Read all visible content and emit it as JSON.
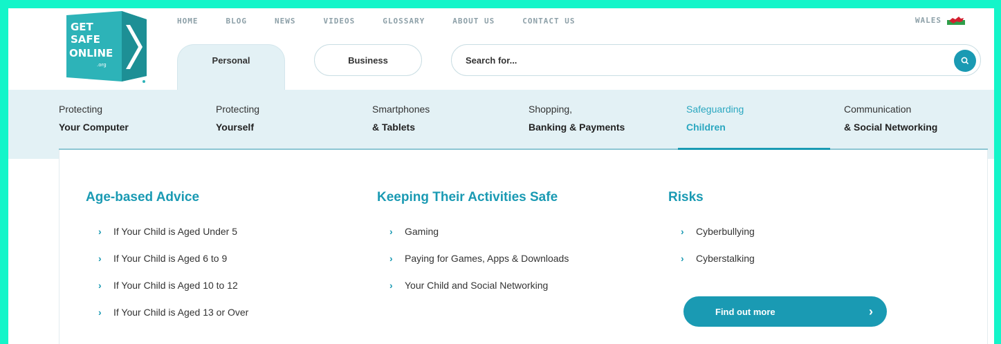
{
  "logo": {
    "line1": "GET",
    "line2": "SAFE",
    "line3": "ONLINE",
    "mark": ".org",
    "color": "#2db3b8"
  },
  "top_nav": [
    "HOME",
    "BLOG",
    "NEWS",
    "VIDEOS",
    "GLOSSARY",
    "ABOUT US",
    "CONTACT US"
  ],
  "region": {
    "label": "WALES",
    "icon": "welsh-flag-icon"
  },
  "tabs": {
    "personal": "Personal",
    "business": "Business"
  },
  "search": {
    "placeholder": "Search for...",
    "icon": "search-icon"
  },
  "categories": [
    {
      "line1": "Protecting",
      "line2": "Your Computer",
      "active": false
    },
    {
      "line1": "Protecting",
      "line2": "Yourself",
      "active": false
    },
    {
      "line1": "Smartphones",
      "line2": "& Tablets",
      "active": false
    },
    {
      "line1": "Shopping,",
      "line2": "Banking & Payments",
      "active": false
    },
    {
      "line1": "Safeguarding",
      "line2": "Children",
      "active": true
    },
    {
      "line1": "Communication",
      "line2": "& Social Networking",
      "active": false
    }
  ],
  "panel": {
    "columns": [
      {
        "title": "Age-based Advice",
        "items": [
          "If Your Child is Aged Under 5",
          "If Your Child is Aged 6 to 9",
          "If Your Child is Aged 10 to 12",
          "If Your Child is Aged 13 or Over"
        ]
      },
      {
        "title": "Keeping Their Activities Safe",
        "items": [
          "Gaming",
          "Paying for Games, Apps & Downloads",
          "Your Child and Social Networking"
        ]
      },
      {
        "title": "Risks",
        "items": [
          "Cyberbullying",
          "Cyberstalking"
        ]
      }
    ],
    "cta": {
      "label": "Find out more",
      "icon": "chevron-right-icon"
    }
  },
  "colors": {
    "accent": "#1a9ab3",
    "frame": "#13f5c9",
    "bar": "#e3f1f5"
  }
}
